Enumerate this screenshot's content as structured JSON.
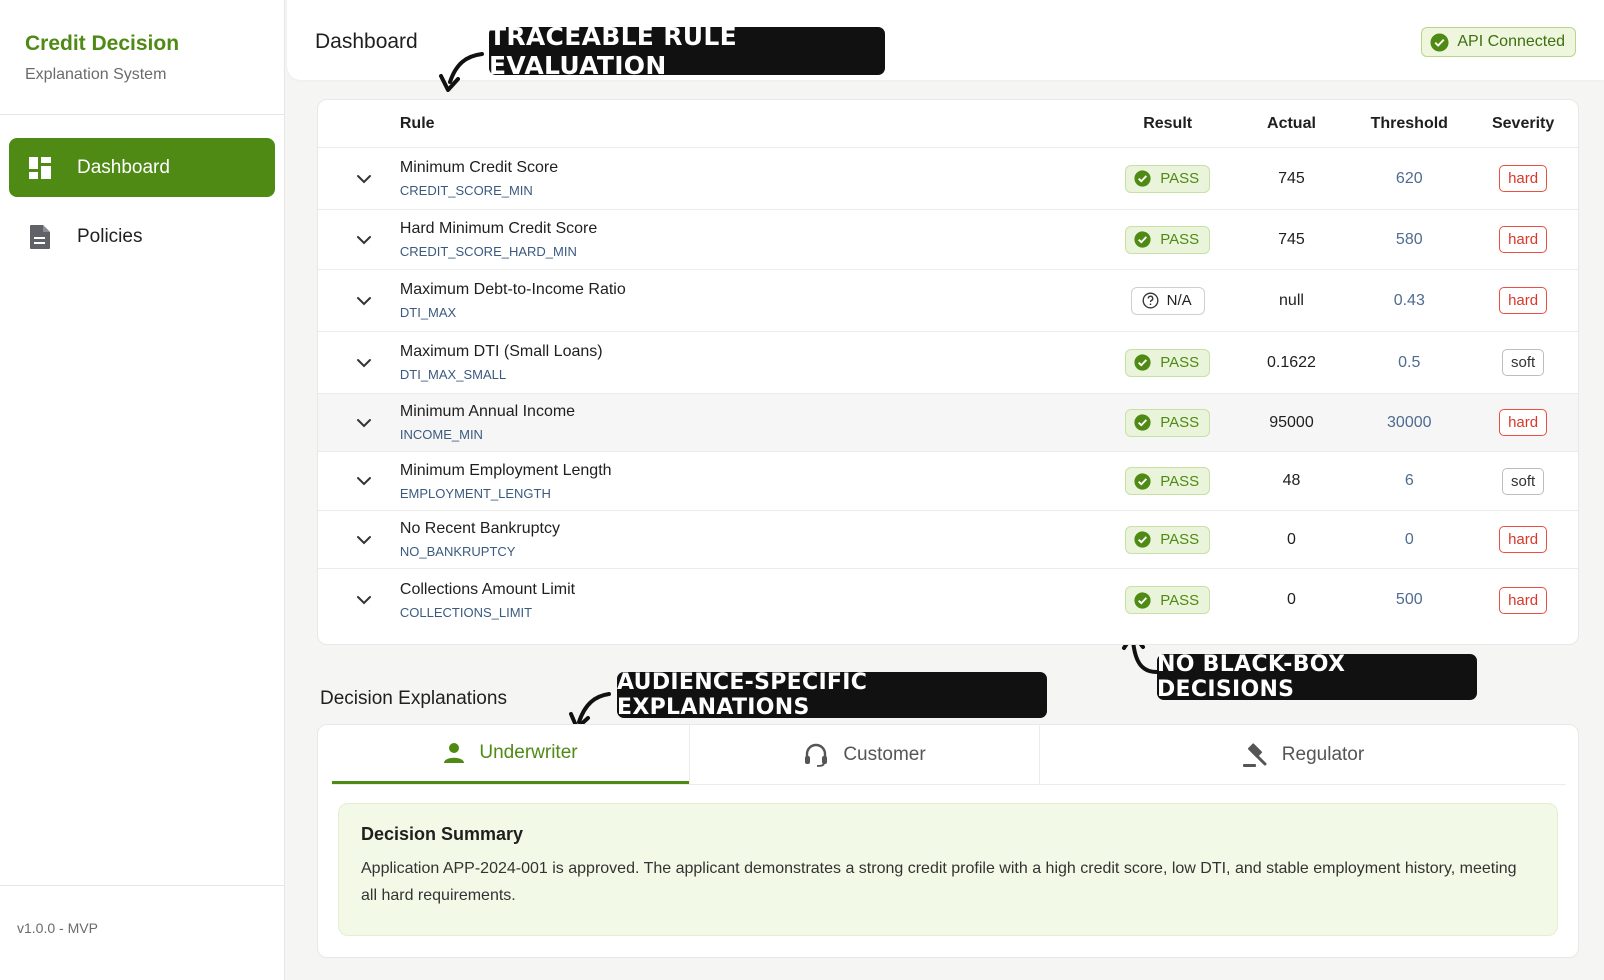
{
  "brand": {
    "title": "Credit Decision",
    "subtitle": "Explanation System"
  },
  "sidebar": {
    "items": [
      {
        "label": "Dashboard",
        "icon": "dashboard-grid-icon",
        "active": true
      },
      {
        "label": "Policies",
        "icon": "document-icon",
        "active": false
      }
    ],
    "version": "v1.0.0 - MVP"
  },
  "header": {
    "title": "Dashboard",
    "api_status": "API Connected"
  },
  "callouts": {
    "rule_eval": "TRACEABLE RULE EVALUATION",
    "no_blackbox": "NO BLACK-BOX DECISIONS",
    "audience": "AUDIENCE-SPECIFIC EXPLANATIONS"
  },
  "rules_table": {
    "headers": {
      "rule": "Rule",
      "result": "Result",
      "actual": "Actual",
      "threshold": "Threshold",
      "severity": "Severity"
    },
    "rows": [
      {
        "name": "Minimum Credit Score",
        "code": "CREDIT_SCORE_MIN",
        "result": "PASS",
        "actual": "745",
        "threshold": "620",
        "severity": "hard"
      },
      {
        "name": "Hard Minimum Credit Score",
        "code": "CREDIT_SCORE_HARD_MIN",
        "result": "PASS",
        "actual": "745",
        "threshold": "580",
        "severity": "hard"
      },
      {
        "name": "Maximum Debt-to-Income Ratio",
        "code": "DTI_MAX",
        "result": "N/A",
        "actual": "null",
        "threshold": "0.43",
        "severity": "hard"
      },
      {
        "name": "Maximum DTI (Small Loans)",
        "code": "DTI_MAX_SMALL",
        "result": "PASS",
        "actual": "0.1622",
        "threshold": "0.5",
        "severity": "soft"
      },
      {
        "name": "Minimum Annual Income",
        "code": "INCOME_MIN",
        "result": "PASS",
        "actual": "95000",
        "threshold": "30000",
        "severity": "hard"
      },
      {
        "name": "Minimum Employment Length",
        "code": "EMPLOYMENT_LENGTH",
        "result": "PASS",
        "actual": "48",
        "threshold": "6",
        "severity": "soft"
      },
      {
        "name": "No Recent Bankruptcy",
        "code": "NO_BANKRUPTCY",
        "result": "PASS",
        "actual": "0",
        "threshold": "0",
        "severity": "hard"
      },
      {
        "name": "Collections Amount Limit",
        "code": "COLLECTIONS_LIMIT",
        "result": "PASS",
        "actual": "0",
        "threshold": "500",
        "severity": "hard"
      }
    ]
  },
  "explanations": {
    "title": "Decision Explanations",
    "tabs": [
      {
        "label": "Underwriter",
        "icon": "person-icon",
        "active": true
      },
      {
        "label": "Customer",
        "icon": "headset-icon",
        "active": false
      },
      {
        "label": "Regulator",
        "icon": "gavel-icon",
        "active": false
      }
    ],
    "summary_title": "Decision Summary",
    "summary_text": "Application APP-2024-001 is approved. The applicant demonstrates a strong credit profile with a high credit score, low DTI, and stable employment history, meeting all hard requirements."
  },
  "colors": {
    "brand_green": "#4e8a14",
    "hard_red": "#d8382a",
    "threshold_blue": "#4f6b8f"
  }
}
